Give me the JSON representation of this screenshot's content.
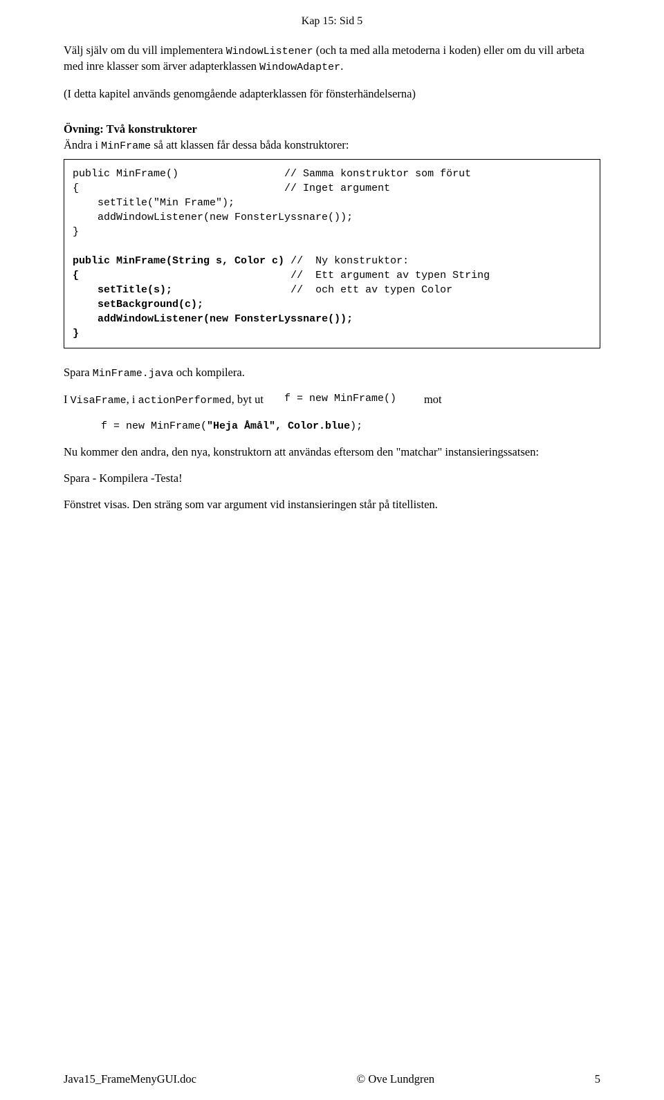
{
  "header": "Kap 15:  Sid 5",
  "intro": {
    "p1a": "Välj själv om du vill implementera ",
    "p1_code1": "WindowListener",
    "p1b": " (och ta med alla metoderna i koden) eller om du vill arbeta med inre klasser som ärver adapterklassen ",
    "p1_code2": "WindowAdapter",
    "p1c": ".",
    "p2": "(I detta kapitel används genomgående adapterklassen för fönsterhändelserna)"
  },
  "exercise": {
    "title": "Övning: Två konstruktorer",
    "line_a": "Ändra i ",
    "line_code": "MinFrame",
    "line_b": "  så att klassen får dessa båda konstruktorer:"
  },
  "code1": "public MinFrame()                 // Samma konstruktor som förut\n{                                 // Inget argument\n    setTitle(\"Min Frame\");\n    addWindowListener(new FonsterLyssnare());\n}\n\npublic MinFrame(String s, Color c) //  Ny konstruktor:\n{                                 //  Ett argument av typen String\n    setTitle(s);                  //  och ett av typen Color\n    setBackground(c);\n    addWindowListener(new FonsterLyssnare());\n}",
  "after": {
    "p3a": "Spara ",
    "p3_code": "MinFrame.java",
    "p3b": "  och kompilera.",
    "p4a": "I ",
    "p4_code1": "VisaFrame",
    "p4b": ", i ",
    "p4_code2": "actionPerformed",
    "p4c": ", byt ut",
    "p4_code3": "f = new MinFrame()",
    "p4d": "mot",
    "code_indent": "f = new MinFrame(\"Heja Åmål\", Color.blue);",
    "p5": "Nu kommer den andra, den nya,  konstruktorn att användas eftersom den \"matchar\" instansieringssatsen:",
    "p6": "Spara - Kompilera -Testa!",
    "p7": "Fönstret visas. Den sträng som var argument vid instansieringen står på titellisten."
  },
  "footer": {
    "left": "Java15_FrameMenyGUI.doc",
    "center": "© Ove Lundgren",
    "right": "5"
  }
}
